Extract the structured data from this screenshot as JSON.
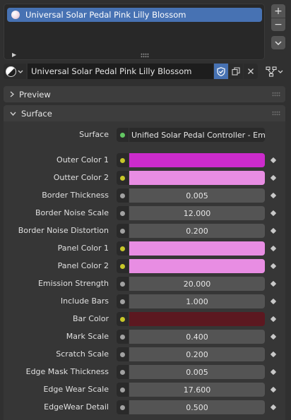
{
  "slots": {
    "items": [
      {
        "label": "Universal Solar Pedal Pink Lilly Blossom"
      }
    ],
    "add_label": "+",
    "remove_label": "−"
  },
  "id_block": {
    "material_name": "Universal Solar Pedal Pink Lilly Blossom"
  },
  "panels": {
    "preview": {
      "title": "Preview",
      "expanded": false
    },
    "surface": {
      "title": "Surface",
      "expanded": true
    }
  },
  "surface": {
    "label": "Surface",
    "shader": "Unified Solar Pedal Controller - Em...",
    "rows": [
      {
        "label": "Outer Color 1",
        "type": "color",
        "socket": "yellow",
        "color": "#cc2bcc"
      },
      {
        "label": "Outter Color 2",
        "type": "color",
        "socket": "yellow",
        "color": "#e88de3"
      },
      {
        "label": "Border Thickness",
        "type": "number",
        "socket": "grey",
        "value": "0.005"
      },
      {
        "label": "Border Noise Scale",
        "type": "number",
        "socket": "grey",
        "value": "12.000"
      },
      {
        "label": "Border Noise Distortion",
        "type": "number",
        "socket": "grey",
        "value": "0.200"
      },
      {
        "label": "Panel Color 1",
        "type": "color",
        "socket": "yellow",
        "color": "#e88de3"
      },
      {
        "label": "Panel Color 2",
        "type": "color",
        "socket": "yellow",
        "color": "#e88de3"
      },
      {
        "label": "Emission Strength",
        "type": "number",
        "socket": "grey",
        "value": "20.000"
      },
      {
        "label": "Include Bars",
        "type": "number",
        "socket": "grey",
        "value": "1.000"
      },
      {
        "label": "Bar Color",
        "type": "color",
        "socket": "yellow",
        "color": "#5c1820"
      },
      {
        "label": "Mark Scale",
        "type": "number",
        "socket": "grey",
        "value": "0.400"
      },
      {
        "label": "Scratch Scale",
        "type": "number",
        "socket": "grey",
        "value": "0.200"
      },
      {
        "label": "Edge Mask Thickness",
        "type": "number",
        "socket": "grey",
        "value": "0.005"
      },
      {
        "label": "Edge Wear Scale",
        "type": "number",
        "socket": "grey",
        "value": "17.600"
      },
      {
        "label": "EdgeWear Detail",
        "type": "number",
        "socket": "grey",
        "value": "0.500"
      }
    ]
  },
  "theme": {
    "accent": "#4772b3",
    "bg": "#303030",
    "panel": "#363636",
    "field": "#545454"
  }
}
